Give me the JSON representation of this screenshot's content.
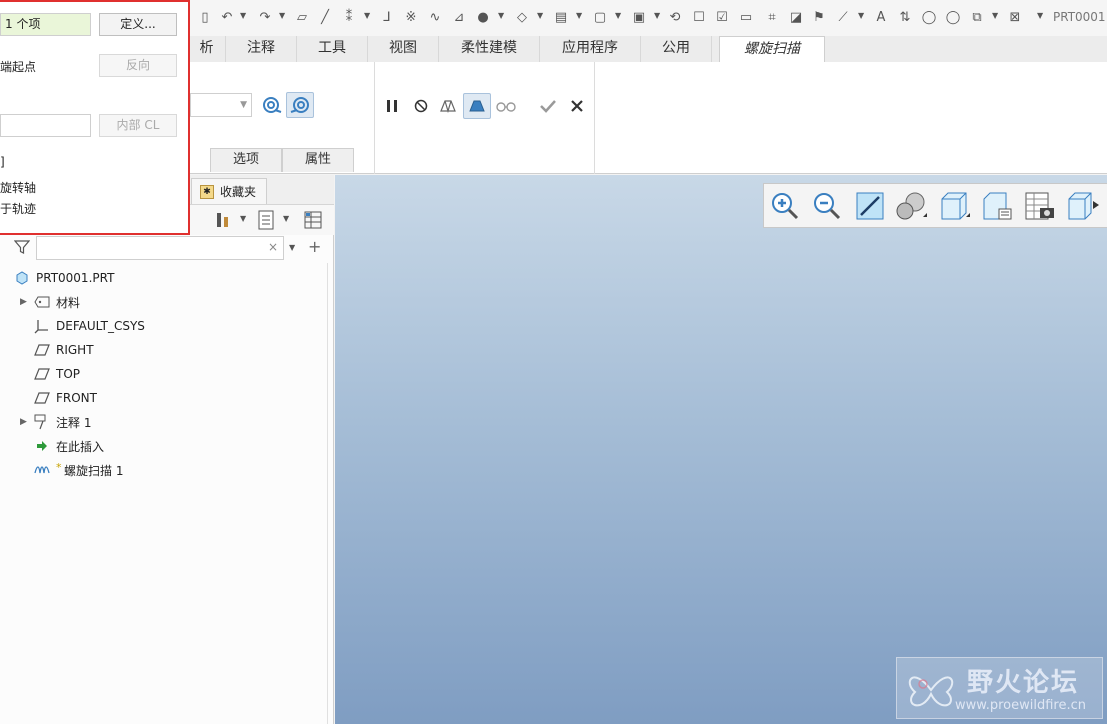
{
  "quick_access": {
    "filename": "PRT0001"
  },
  "tabs": [
    {
      "label": "析"
    },
    {
      "label": "注释"
    },
    {
      "label": "工具"
    },
    {
      "label": "视图"
    },
    {
      "label": "柔性建模"
    },
    {
      "label": "应用程序"
    },
    {
      "label": "公用"
    },
    {
      "label": "螺旋扫描"
    }
  ],
  "ribbon": {
    "subtabs": [
      "选项",
      "属性"
    ]
  },
  "ref_panel": {
    "profile_value": "1 个项",
    "define_button": "定义...",
    "start_point_label": "端起点",
    "reverse_button": "反向",
    "internal_cl_button": "内部 CL",
    "line_1": "]",
    "line_2": "旋转轴",
    "line_3": "于轨迹"
  },
  "navigator": {
    "favorites_tab": "收藏夹"
  },
  "tree": {
    "filter_placeholder": "",
    "nodes": [
      {
        "label": "PRT0001.PRT",
        "icon": "part-icon"
      },
      {
        "label": "材料",
        "icon": "material-icon",
        "expandable": true
      },
      {
        "label": "DEFAULT_CSYS",
        "icon": "csys-icon"
      },
      {
        "label": "RIGHT",
        "icon": "datum-plane-icon"
      },
      {
        "label": "TOP",
        "icon": "datum-plane-icon"
      },
      {
        "label": "FRONT",
        "icon": "datum-plane-icon"
      },
      {
        "label": "注释 1",
        "icon": "annotation-icon",
        "expandable": true
      },
      {
        "label": "在此插入",
        "icon": "insert-here-icon"
      },
      {
        "label": "螺旋扫描 1",
        "icon": "helical-sweep-icon",
        "prefix": "*"
      }
    ]
  },
  "watermark": {
    "title": "野火论坛",
    "url": "www.proewildfire.cn"
  },
  "colors": {
    "highlight": "#e0302f",
    "accent": "#1f6fb5"
  }
}
